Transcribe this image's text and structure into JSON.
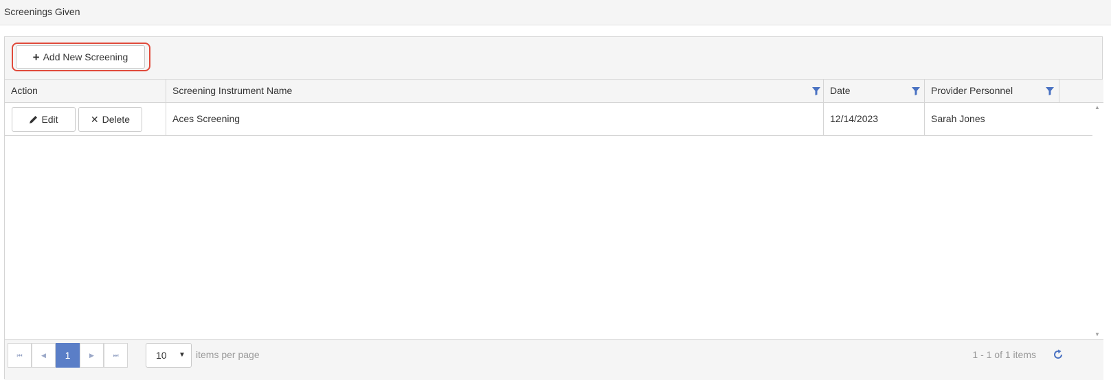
{
  "page": {
    "title": "Screenings Given"
  },
  "toolbar": {
    "add_label": "Add New Screening"
  },
  "table": {
    "headers": {
      "action": "Action",
      "instrument": "Screening Instrument Name",
      "date": "Date",
      "provider": "Provider Personnel"
    },
    "rows": [
      {
        "edit_label": "Edit",
        "delete_label": "Delete",
        "instrument": "Aces Screening",
        "date": "12/14/2023",
        "provider": "Sarah Jones"
      }
    ]
  },
  "pager": {
    "current_page": "1",
    "page_size": "10",
    "items_per_page_label": "items per page",
    "info": "1 - 1 of 1 items"
  },
  "icons": {
    "plus": "+",
    "delete": "✕",
    "first": "⏮",
    "prev": "◀",
    "next": "▶",
    "last": "⏭",
    "caret": "▼",
    "scroll_up": "▲",
    "scroll_down": "▼"
  },
  "colors": {
    "highlight": "#e0493a",
    "filter_icon": "#4a72c2",
    "pager_active": "#5a7ec7",
    "toolbar_bg": "#f5f5f5"
  }
}
